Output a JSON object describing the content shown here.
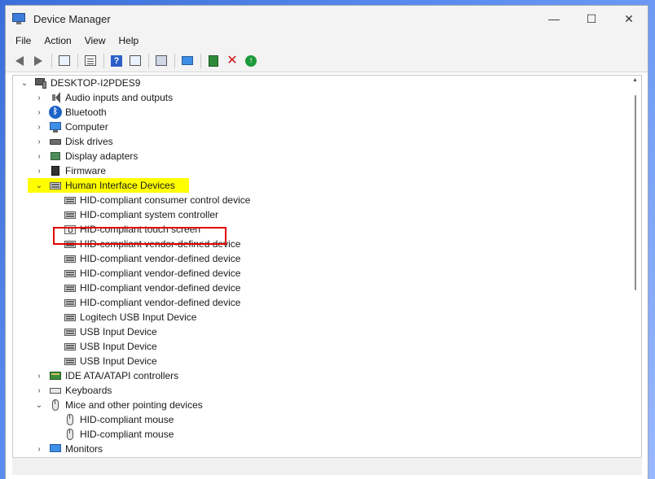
{
  "window": {
    "title": "Device Manager",
    "controls": {
      "minimize": "—",
      "maximize": "☐",
      "close": "✕"
    }
  },
  "menu": [
    "File",
    "Action",
    "View",
    "Help"
  ],
  "toolbar": {
    "buttons": [
      "back-icon",
      "forward-icon",
      "properties-pane-icon",
      "properties-icon",
      "help-icon",
      "view-icon",
      "scan-hardware-icon",
      "monitor-icon",
      "update-driver-icon",
      "uninstall-icon",
      "enable-device-icon"
    ],
    "help_glyph": "?",
    "uninstall_glyph": "✕",
    "enable_glyph": "↑"
  },
  "tree": {
    "root": "DESKTOP-I2PDES9",
    "expander_collapsed": "›",
    "expander_expanded": "⌄",
    "categories": [
      {
        "label": "Audio inputs and outputs",
        "icon": "audio-icon"
      },
      {
        "label": "Bluetooth",
        "icon": "bluetooth-icon",
        "glyph": "ᛒ"
      },
      {
        "label": "Computer",
        "icon": "computer-icon"
      },
      {
        "label": "Disk drives",
        "icon": "disk-icon"
      },
      {
        "label": "Display adapters",
        "icon": "display-adapter-icon"
      },
      {
        "label": "Firmware",
        "icon": "firmware-icon"
      }
    ],
    "hid": {
      "label": "Human Interface Devices",
      "highlight_color": "#ffff00",
      "children": [
        "HID-compliant consumer control device",
        "HID-compliant system controller",
        "HID-compliant touch screen",
        "HID-compliant vendor-defined device",
        "HID-compliant vendor-defined device",
        "HID-compliant vendor-defined device",
        "HID-compliant vendor-defined device",
        "HID-compliant vendor-defined device",
        "Logitech USB Input Device",
        "USB Input Device",
        "USB Input Device",
        "USB Input Device"
      ],
      "boxed_item_color": "#e00000"
    },
    "after_hid": [
      {
        "label": "IDE ATA/ATAPI controllers",
        "icon": "ide-icon"
      },
      {
        "label": "Keyboards",
        "icon": "keyboard-icon"
      }
    ],
    "mice": {
      "label": "Mice and other pointing devices",
      "children": [
        "HID-compliant mouse",
        "HID-compliant mouse"
      ]
    },
    "monitors": {
      "label": "Monitors"
    }
  }
}
